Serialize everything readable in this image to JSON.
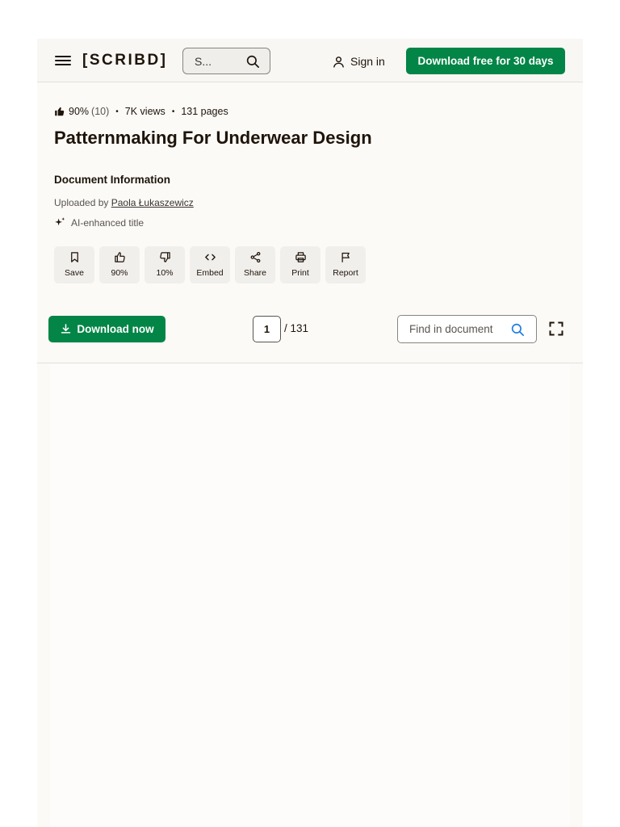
{
  "header": {
    "logo": "[SCRIBD]",
    "search_placeholder": "S...",
    "sign_in": "Sign in",
    "cta": "Download free for 30 days"
  },
  "meta": {
    "rating": "90%",
    "rating_count": "(10)",
    "views": "7K views",
    "pages": "131 pages"
  },
  "title": "Patternmaking For Underwear Design",
  "info": {
    "heading": "Document Information",
    "uploaded_prefix": "Uploaded by",
    "uploader": "Paola Łukaszewicz",
    "ai_label": "AI-enhanced title"
  },
  "actions": {
    "save": "Save",
    "upvote": "90%",
    "downvote": "10%",
    "embed": "Embed",
    "share": "Share",
    "print": "Print",
    "report": "Report"
  },
  "toolbar": {
    "download": "Download now",
    "current_page": "1",
    "total_pages": "/ 131",
    "find_placeholder": "Find in document"
  },
  "colors": {
    "brand_green": "#028546",
    "text": "#1e1409",
    "search_icon_blue": "#1e7ce0"
  }
}
